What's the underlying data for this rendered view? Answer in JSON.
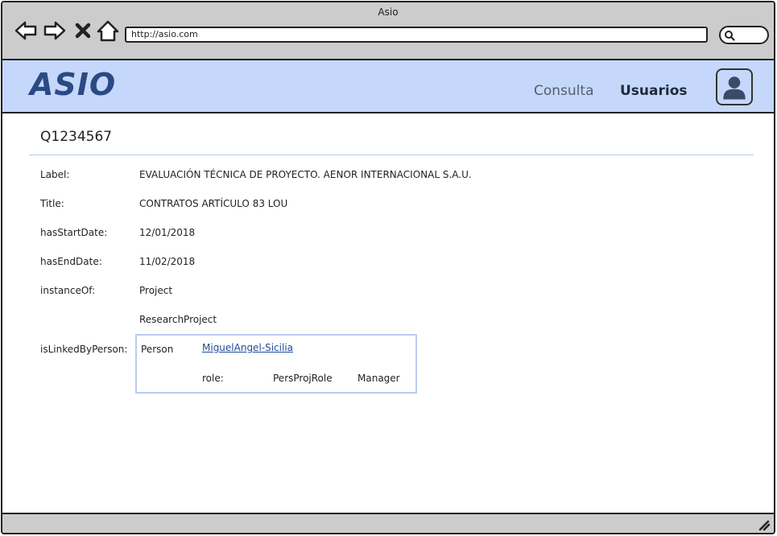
{
  "window": {
    "title": "Asio"
  },
  "browser": {
    "url": "http://asio.com",
    "icons": [
      "back-arrow-icon",
      "forward-arrow-icon",
      "close-icon",
      "home-icon",
      "search-icon"
    ]
  },
  "header": {
    "brand": "ASIO",
    "nav": {
      "consulta": "Consulta",
      "usuarios": "Usuarios"
    },
    "avatar_icon": "user-avatar-icon",
    "background": "#c5d8fb",
    "brand_color": "#2b4a84"
  },
  "main": {
    "title": "Q1234567",
    "properties": {
      "label": {
        "key": "Label:",
        "value": "EVALUACIÓN TÉCNICA DE PROYECTO. AENOR INTERNACIONAL S.A.U."
      },
      "title": {
        "key": "Title:",
        "value": "CONTRATOS ARTÍCULO 83 LOU"
      },
      "start": {
        "key": "hasStartDate:",
        "value": "12/01/2018"
      },
      "end": {
        "key": "hasEndDate:",
        "value": "11/02/2018"
      },
      "instance": {
        "key": "instanceOf:",
        "values": [
          "Project",
          "ResearchProject"
        ]
      },
      "linked": {
        "key": "isLinkedByPerson:",
        "type": "Person",
        "person": "MiguelAngel-Sicilia",
        "role_label": "role:",
        "role_type": "PersProjRole",
        "role_value": "Manager"
      }
    }
  }
}
